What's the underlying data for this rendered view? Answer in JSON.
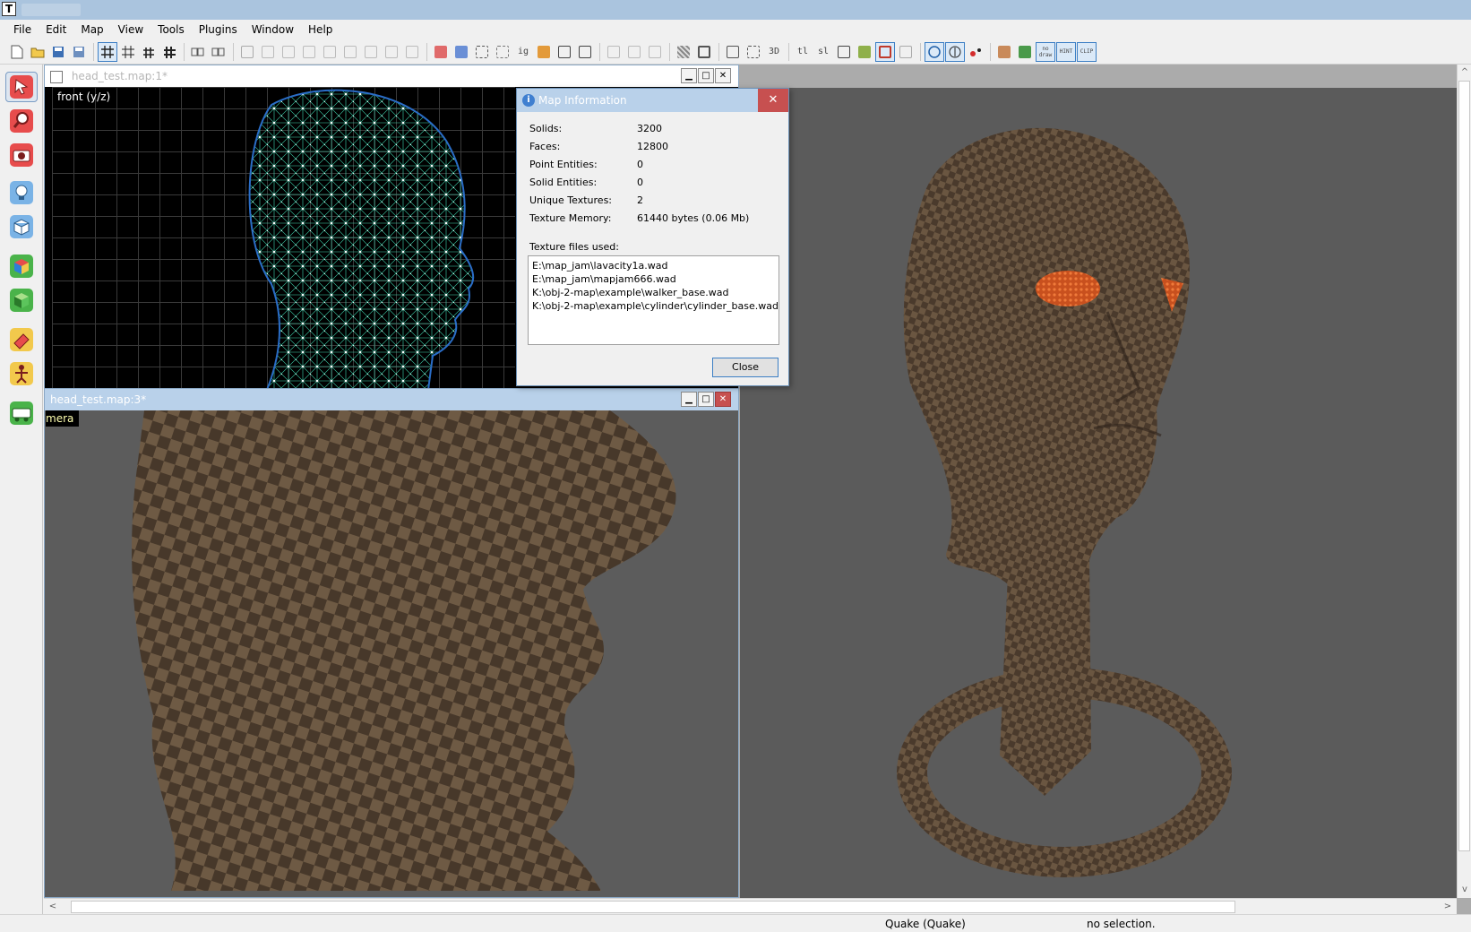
{
  "menu": [
    "File",
    "Edit",
    "Map",
    "View",
    "Tools",
    "Plugins",
    "Window",
    "Help"
  ],
  "toolbar": {
    "text_buttons": [
      "tl",
      "sl"
    ],
    "boxed_labels": [
      "no draw",
      "HINT",
      "CLIP"
    ]
  },
  "icons": {
    "tools": [
      "select-arrow-icon",
      "magnifier-icon",
      "camera-icon",
      "light-bulb-icon",
      "cube-outline-icon",
      "cube-color-icon",
      "cube-green-icon",
      "texture-paint-icon",
      "entity-skeleton-icon",
      "vehicle-icon"
    ]
  },
  "windows": {
    "top": {
      "title": "head_test.map:1*",
      "view_label": "front (y/z)"
    },
    "bottom": {
      "title": "head_test.map:3*",
      "view_label": "mera"
    }
  },
  "dialog": {
    "title": "Map Information",
    "close_glyph": "✕",
    "rows": [
      {
        "label": "Solids:",
        "value": "3200"
      },
      {
        "label": "Faces:",
        "value": "12800"
      },
      {
        "label": "Point Entities:",
        "value": "0"
      },
      {
        "label": "Solid Entities:",
        "value": "0"
      },
      {
        "label": "Unique Textures:",
        "value": "2"
      },
      {
        "label": "Texture Memory:",
        "value": "61440 bytes (0.06 Mb)"
      }
    ],
    "texture_files_label": "Texture files used:",
    "texture_files": [
      "E:\\map_jam\\lavacity1a.wad",
      "E:\\map_jam\\mapjam666.wad",
      "K:\\obj-2-map\\example\\walker_base.wad",
      "K:\\obj-2-map\\example\\cylinder\\cylinder_base.wad"
    ],
    "close_button": "Close"
  },
  "status": {
    "game": "Quake (Quake)",
    "selection": "no selection."
  },
  "colors": {
    "title_bar": "#aac4de",
    "active_caption": "#b9d1ea",
    "close_red": "#c75050",
    "viewport_grey": "#5b5b5b"
  }
}
